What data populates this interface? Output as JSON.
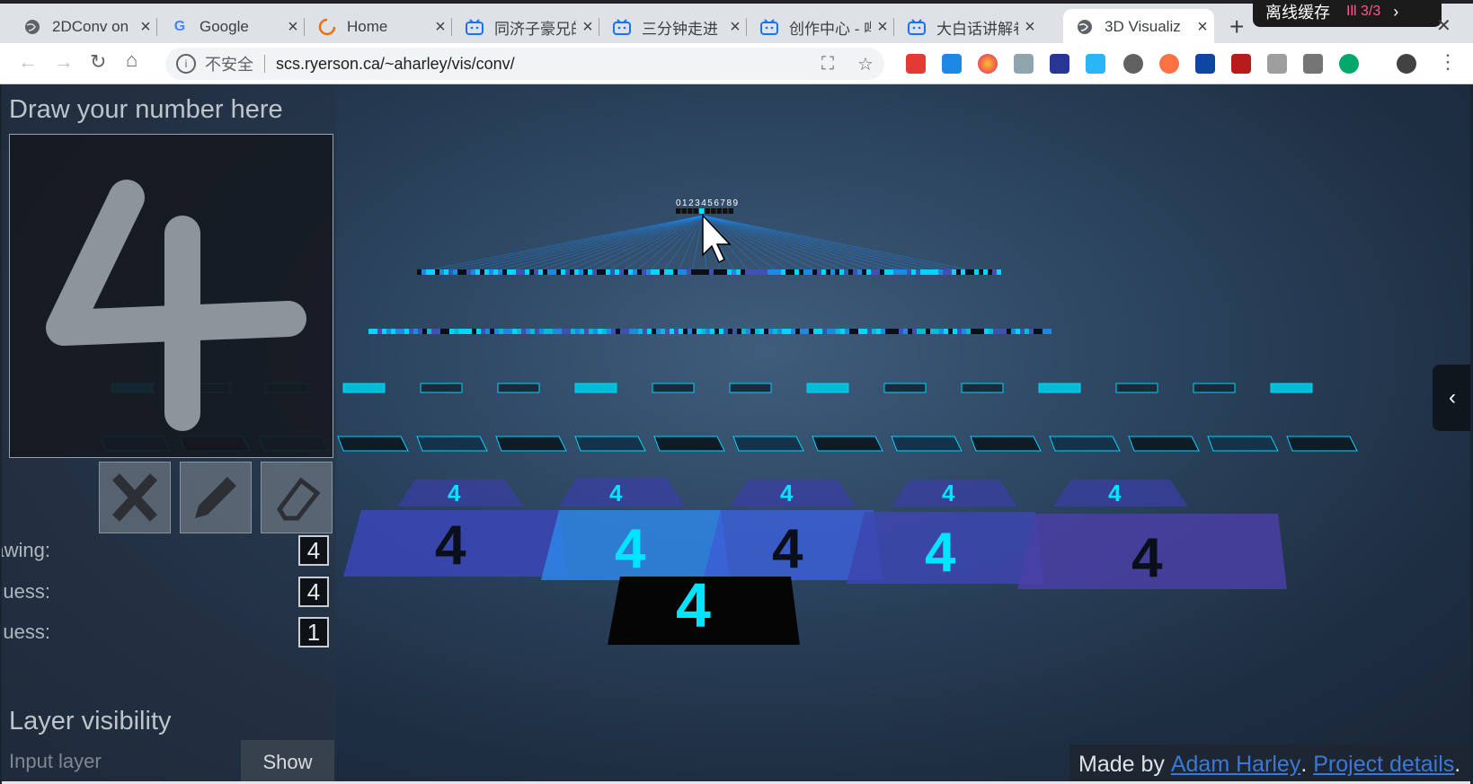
{
  "browser": {
    "tabs": [
      {
        "title": "2DConv on",
        "icon": "globe-icon"
      },
      {
        "title": "Google",
        "icon": "google-icon"
      },
      {
        "title": "Home",
        "icon": "loading-icon"
      },
      {
        "title": "同济子豪兄的",
        "icon": "bilibili-icon"
      },
      {
        "title": "三分钟走进",
        "icon": "bilibili-icon"
      },
      {
        "title": "创作中心 - 哔",
        "icon": "bilibili-icon"
      },
      {
        "title": "大白话讲解卷",
        "icon": "bilibili-icon"
      },
      {
        "title": "3D Visualiz",
        "icon": "globe-icon"
      }
    ],
    "overlay": {
      "label": "离线缓存",
      "counter": "3/3"
    },
    "address": {
      "security_label": "不安全",
      "url": "scs.ryerson.ca/~aharley/vis/conv/"
    }
  },
  "page": {
    "draw_title": "Draw your number here",
    "drawn_digit": "4",
    "output_labels": "0123456789",
    "downsampled_label": "Downsampled drawing:",
    "downsampled_value": "4",
    "first_guess_label": "First guess:",
    "first_guess_value": "4",
    "second_guess_label": "Second guess:",
    "second_guess_value": "1",
    "layer_visibility_title": "Layer visibility",
    "input_layer_label": "Input layer",
    "show_button": "Show",
    "footer": {
      "prefix": "Made by ",
      "author": "Adam Harley",
      "sep": ". ",
      "details": "Project details",
      "suffix": "."
    },
    "sidetab_icon": "chevron-left-icon"
  },
  "colors": {
    "accent": "#00c8ff",
    "link": "#3b78d8",
    "background": "#2c4560"
  }
}
